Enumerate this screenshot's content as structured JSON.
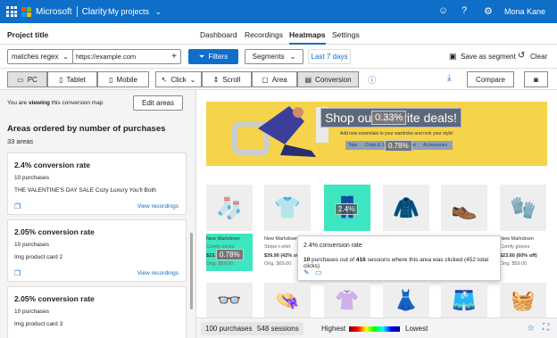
{
  "topbar": {
    "brand": "Microsoft",
    "app": "Clarity",
    "projects": "My projects",
    "user": "Mona Kane"
  },
  "subnav": {
    "project_title": "Project title",
    "tabs": [
      "Dashboard",
      "Recordings",
      "Heatmaps",
      "Settings"
    ],
    "active_tab": "Heatmaps"
  },
  "filterbar": {
    "match_type": "matches regex",
    "url": "https://example.com",
    "filters": "Filters",
    "segments": "Segments",
    "daterange": "Last 7 days",
    "save_segment": "Save as segment",
    "clear": "Clear"
  },
  "toolbar": {
    "devices": [
      "PC",
      "Tablet",
      "Mobile"
    ],
    "modes": [
      "Click",
      "Scroll",
      "Area",
      "Conversion"
    ],
    "compare": "Compare"
  },
  "sidebar": {
    "viewing_prefix": "You are",
    "viewing_bold": "viewing",
    "viewing_suffix": "this conversion map",
    "edit_areas": "Edit areas",
    "heading": "Areas ordered by number of purchases",
    "count": "33 areas",
    "cards": [
      {
        "title": "2.4% conversion rate",
        "purchases": "10 purchases",
        "name": "THE VALENTINE'S DAY SALE Cozy Luxury You'll Both",
        "link": "View recordings"
      },
      {
        "title": "2.05% conversion rate",
        "purchases": "10 purchases",
        "name": "Img product card 2",
        "link": "View recordings"
      },
      {
        "title": "2.05% conversion rate",
        "purchases": "10 purchases",
        "name": "Img product card 3",
        "link": ""
      }
    ]
  },
  "page": {
    "banner_title": "Shop our favorite deals!",
    "banner_sub": "Add new essentials to your wardrobe and rock your style!",
    "banner_links": [
      "Tops",
      "Coats & Jackets",
      "Home",
      "Accessories"
    ],
    "bubbles": [
      "0.33%",
      "0.78%",
      "2.4%",
      "0.78%"
    ],
    "products": [
      {
        "label": "New Markdown",
        "name": "Comfy socks",
        "price": "$23.60",
        "orig": "Orig. $59.00"
      },
      {
        "label": "New Markdown",
        "name": "Stripe t-shirt",
        "price": "$39.90 (42% off)",
        "orig": "Orig. $69.00"
      },
      {
        "label": "",
        "name": "",
        "price": "",
        "orig": ""
      },
      {
        "label": "",
        "name": "",
        "price": "",
        "orig": ""
      },
      {
        "label": "",
        "name": "",
        "price": "",
        "orig": ""
      },
      {
        "label": "New Markdown",
        "name": "Comfy gloves",
        "price": "$23.60 (60% off)",
        "orig": "Orig. $59.00"
      }
    ],
    "tooltip": {
      "title": "2.4% conversion rate",
      "purchases": "10",
      "mid1": "purchases out of",
      "sessions": "416",
      "mid2": "sessions where this area was clicked (452 total clicks)"
    }
  },
  "bottombar": {
    "purchases": "100 purchases",
    "sessions": "548 sessions",
    "highest": "Highest",
    "lowest": "Lowest"
  },
  "colors": {
    "brand": "#0e6ec8",
    "banner": "#f5d34b",
    "highlight": "#3de6c0"
  }
}
